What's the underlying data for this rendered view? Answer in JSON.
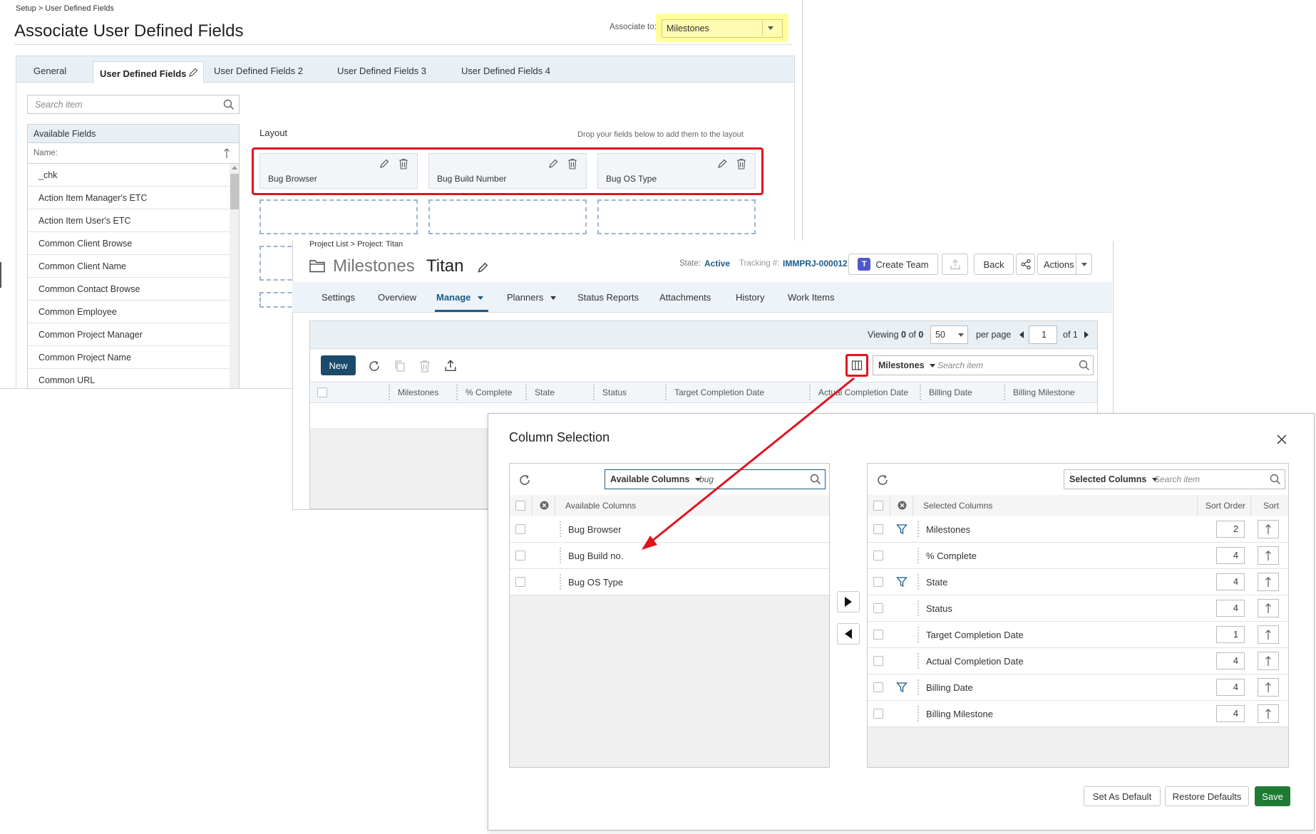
{
  "udf": {
    "breadcrumb": "Setup > User Defined Fields",
    "title": "Associate User Defined Fields",
    "associate_label": "Associate to:",
    "associate_value": "Milestones",
    "tabs": [
      "General",
      "User Defined Fields",
      "User Defined Fields 2",
      "User Defined Fields 3",
      "User Defined Fields 4"
    ],
    "search_placeholder": "Search item",
    "available_fields_title": "Available Fields",
    "name_header": "Name:",
    "fields": [
      "_chk",
      "Action Item Manager's ETC",
      "Action Item User's ETC",
      "Common Client Browse",
      "Common Client Name",
      "Common Contact Browse",
      "Common Employee",
      "Common Project Manager",
      "Common Project Name",
      "Common URL"
    ],
    "layout_label": "Layout",
    "layout_hint": "Drop your fields below to add them to the layout",
    "layout_cards": [
      "Bug Browser",
      "Bug Build Number",
      "Bug OS Type"
    ]
  },
  "proj": {
    "breadcrumb": "Project List > Project: Titan",
    "title_prefix": "Milestones",
    "title_name": "Titan",
    "state_label": "State:",
    "state_value": "Active",
    "tracking_label": "Tracking #:",
    "tracking_value": "IMMPRJ-000012",
    "create_team": "Create Team",
    "back": "Back",
    "actions": "Actions",
    "tabs": [
      "Settings",
      "Overview",
      "Manage",
      "Planners",
      "Status Reports",
      "Attachments",
      "History",
      "Work Items"
    ],
    "viewing_label": "Viewing",
    "viewing_a": "0",
    "viewing_of": "of",
    "viewing_b": "0",
    "per_page_value": "50",
    "per_page_label": "per page",
    "page_value": "1",
    "of_pages": "of 1",
    "new_button": "New",
    "view_select": "Milestones",
    "search_placeholder": "Search item",
    "columns": [
      "Milestones",
      "% Complete",
      "State",
      "Status",
      "Target Completion Date",
      "Actual Completion Date",
      "Billing Date",
      "Billing Milestone"
    ]
  },
  "dialog": {
    "title": "Column Selection",
    "available_select": "Available Columns",
    "available_search_value": "bug",
    "available_header": "Available Columns",
    "available_items": [
      "Bug Browser",
      "Bug Build no.",
      "Bug OS Type"
    ],
    "selected_select": "Selected Columns",
    "selected_search_placeholder": "Search item",
    "selected_header": "Selected Columns",
    "sort_order_header": "Sort Order",
    "sort_header": "Sort",
    "selected_items": [
      {
        "name": "Milestones",
        "order": "2",
        "filter": true
      },
      {
        "name": "% Complete",
        "order": "4",
        "filter": false
      },
      {
        "name": "State",
        "order": "4",
        "filter": true
      },
      {
        "name": "Status",
        "order": "4",
        "filter": false
      },
      {
        "name": "Target Completion Date",
        "order": "1",
        "filter": false
      },
      {
        "name": "Actual Completion Date",
        "order": "4",
        "filter": false
      },
      {
        "name": "Billing Date",
        "order": "4",
        "filter": true
      },
      {
        "name": "Billing Milestone",
        "order": "4",
        "filter": false
      }
    ],
    "set_default": "Set As Default",
    "restore_defaults": "Restore Defaults",
    "save": "Save"
  },
  "colors": {
    "accent": "#1a5a87",
    "highlight": "#ffff99",
    "callout": "#e0141e",
    "save": "#1e7b34"
  }
}
